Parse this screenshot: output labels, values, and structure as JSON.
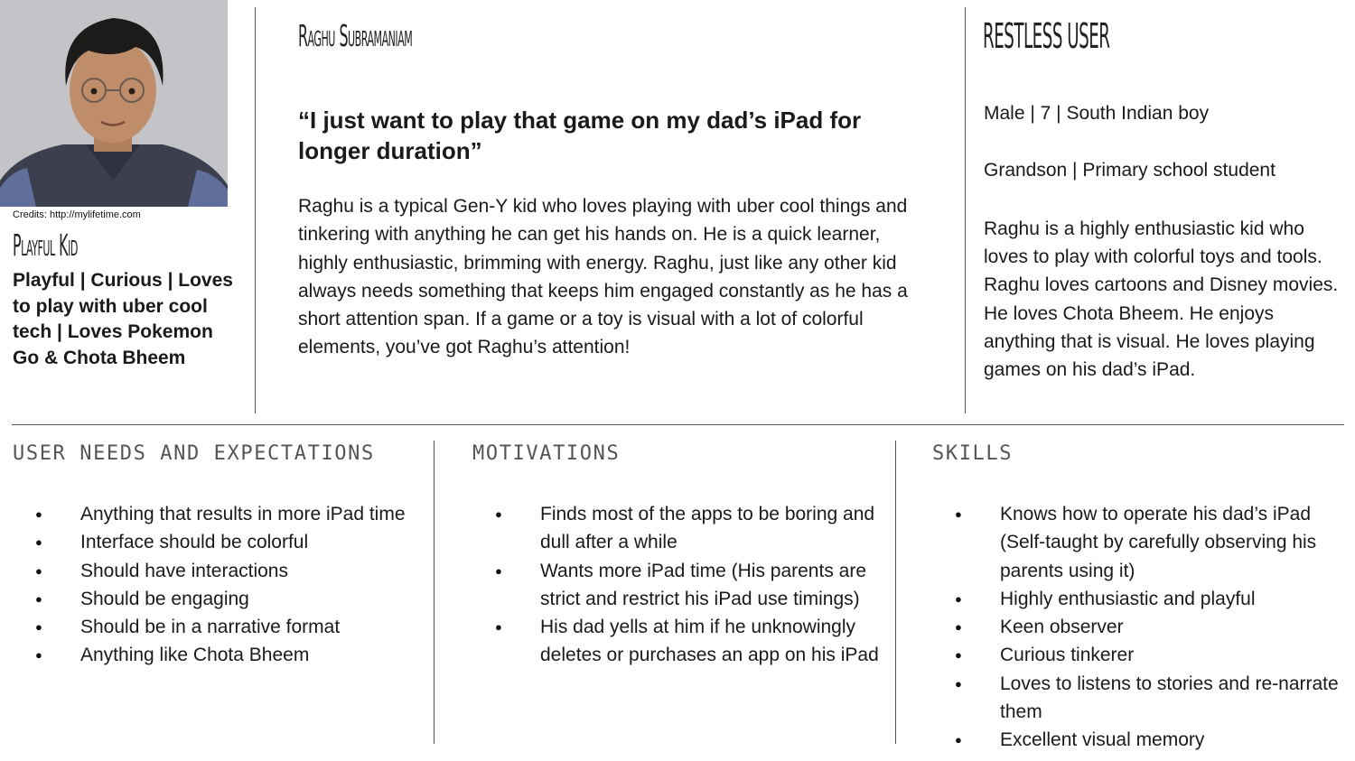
{
  "persona": {
    "photo_credit": "Credits: http://mylifetime.com",
    "type_label": "Playful Kid",
    "type_description": "Playful |  Curious | Loves to play with uber cool tech | Loves Pokemon Go & Chota Bheem",
    "name": "Raghu Subramaniam",
    "quote": "“I just want to play that game on my dad’s iPad for longer duration”",
    "bio": "Raghu is a typical Gen-Y kid who loves playing with uber cool things and tinkering with anything he can get his hands on. He is a quick learner, highly enthusiastic, brimming with energy. Raghu, just like any other kid always needs something that keeps him engaged constantly as he has a short attention span. If a game or a toy is visual with a lot of colorful elements, you’ve got Raghu’s attention!",
    "user_type": "RESTLESS USER",
    "demographics_line1": "Male | 7 | South Indian boy",
    "demographics_line2": "Grandson | Primary school student",
    "user_description": "Raghu is a highly enthusiastic kid who loves to play with colorful toys and tools. Raghu loves cartoons and Disney movies. He loves Chota Bheem. He enjoys anything that is visual. He loves playing games on his dad’s iPad."
  },
  "sections": [
    {
      "title": "USER NEEDS AND EXPECTATIONS",
      "items": [
        "Anything that results in more iPad time",
        "Interface should be colorful",
        "Should have interactions",
        "Should be engaging",
        "Should be in a narrative format",
        "Anything like Chota Bheem"
      ]
    },
    {
      "title": "MOTIVATIONS",
      "items": [
        "Finds most of the apps to be boring and dull after a while",
        "Wants more iPad time (His parents are strict and restrict his iPad use timings)",
        "His dad yells at him if he unknowingly deletes or purchases an app on his iPad"
      ]
    },
    {
      "title": "SKILLS",
      "items": [
        "Knows how to operate his dad’s iPad (Self-taught by carefully observing his parents using it)",
        "Highly enthusiastic and playful",
        "Keen observer",
        "Curious tinkerer",
        "Loves to listens to stories and re-narrate them",
        "Excellent visual memory"
      ]
    }
  ]
}
